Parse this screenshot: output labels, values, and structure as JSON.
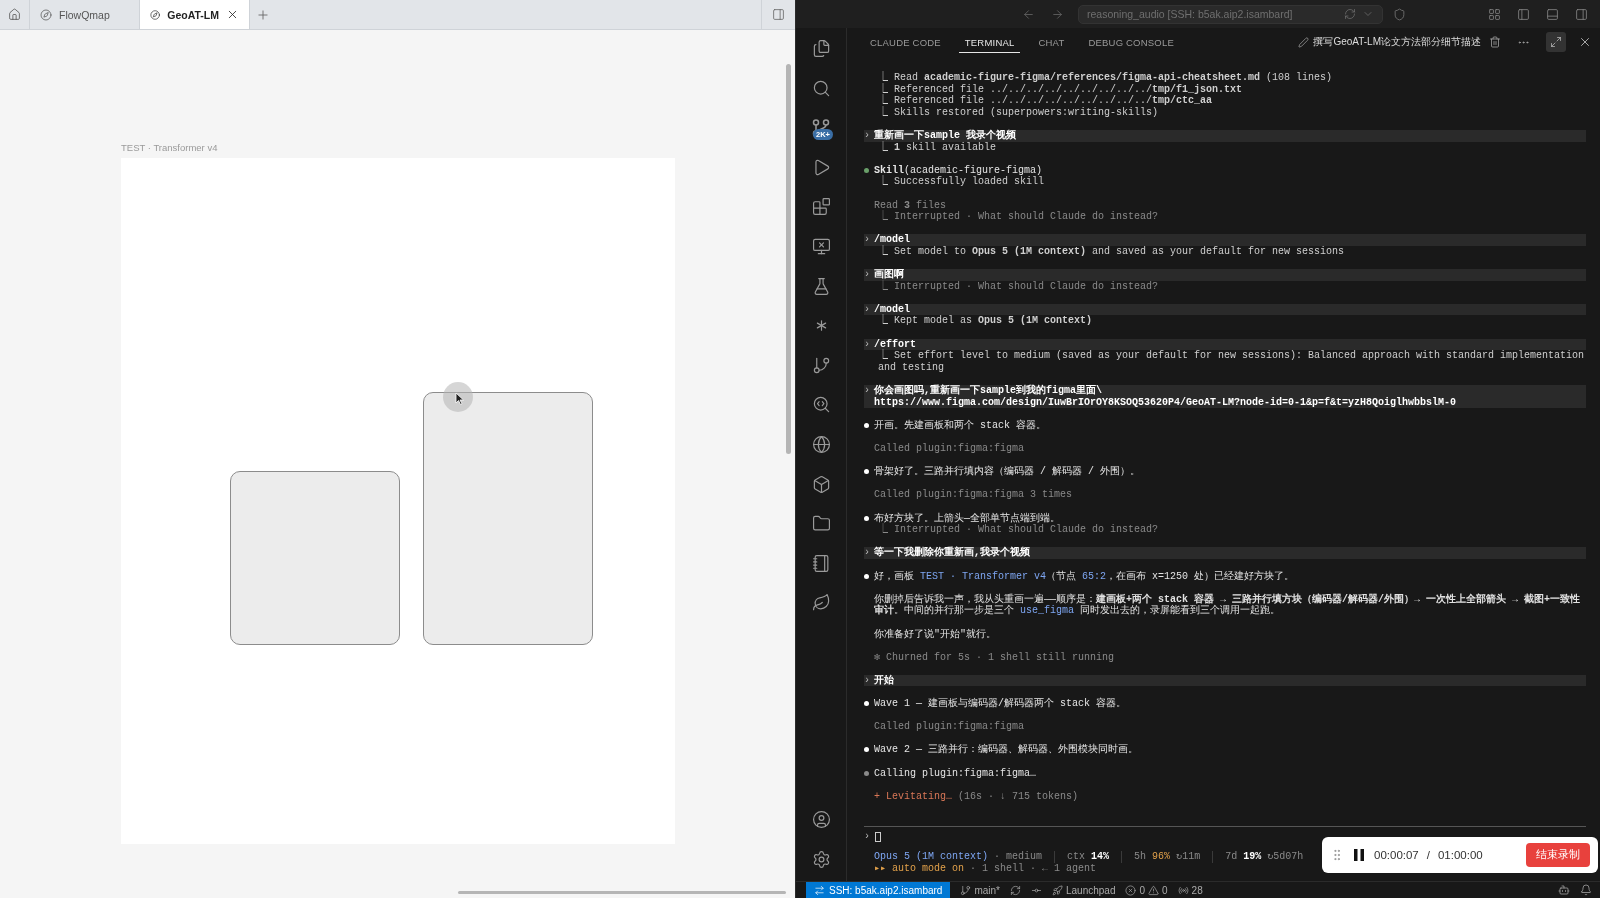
{
  "browser": {
    "tabs": [
      {
        "label": "FlowQmap",
        "selected": false
      },
      {
        "label": "GeoAT-LM",
        "selected": true
      }
    ]
  },
  "canvas": {
    "frame_label": "TEST · Transformer v4"
  },
  "editor": {
    "title_search": "reasoning_audio [SSH: b5ak.aip2.isambard]",
    "activity_badge": "2K+",
    "panel_tabs": [
      {
        "label": "CLAUDE CODE",
        "selected": false
      },
      {
        "label": "TERMINAL",
        "selected": true
      },
      {
        "label": "CHAT",
        "selected": false
      },
      {
        "label": "DEBUG CONSOLE",
        "selected": false
      }
    ],
    "session_title": "撰写GeoAT-LM论文方法部分细节描述"
  },
  "terminal": {
    "groups": [
      {
        "lines": [
          {
            "kind": "tree",
            "muted": false,
            "text": "⎿ Read **academic-figure-figma/references/figma-api-cheatsheet.md** (108 lines)"
          },
          {
            "kind": "tree",
            "muted": false,
            "text": "⎿ Referenced file ../../../../../../../../../**tmp/f1_json.txt**"
          },
          {
            "kind": "tree",
            "muted": false,
            "text": "⎿ Referenced file ../../../../../../../../../**tmp/ctc_aa**"
          },
          {
            "kind": "tree",
            "muted": false,
            "text": "⎿ Skills restored (superpowers:writing-skills)"
          }
        ]
      },
      {
        "lines": [
          {
            "kind": "prompt",
            "marker": "›",
            "text": "重新画一下sample 我录个视频"
          },
          {
            "kind": "tree",
            "muted": false,
            "text": "⎿ **1** skill available"
          }
        ]
      },
      {
        "lines": [
          {
            "kind": "bullet",
            "color": "#6aa06a",
            "text": "**Skill**(academic-figure-figma)"
          },
          {
            "kind": "tree",
            "muted": false,
            "text": "⎿ Successfully loaded skill"
          }
        ]
      },
      {
        "lines": [
          {
            "kind": "note",
            "muted": true,
            "text": "Read **3** files"
          },
          {
            "kind": "tree",
            "muted": true,
            "text": "⎿ Interrupted · What should Claude do instead?"
          }
        ]
      },
      {
        "lines": [
          {
            "kind": "prompt",
            "marker": "›",
            "text": "/model"
          },
          {
            "kind": "tree",
            "muted": false,
            "text": "⎿ Set model to **Opus 5 (1M context)** and saved as your default for new sessions"
          }
        ]
      },
      {
        "lines": [
          {
            "kind": "prompt",
            "marker": "›",
            "text": "画图啊"
          },
          {
            "kind": "tree",
            "muted": true,
            "text": "⎿ Interrupted · What should Claude do instead?"
          }
        ]
      },
      {
        "lines": [
          {
            "kind": "prompt",
            "marker": "›",
            "text": "/model"
          },
          {
            "kind": "tree",
            "muted": false,
            "text": "⎿ Kept model as **Opus 5 (1M context)**"
          }
        ]
      },
      {
        "lines": [
          {
            "kind": "prompt",
            "marker": "›",
            "text": "/effort"
          },
          {
            "kind": "tree",
            "muted": false,
            "text": "⎿ Set effort level to medium (saved as your default for new sessions): Balanced approach with standard implementation and testing"
          }
        ]
      },
      {
        "lines": [
          {
            "kind": "prompt",
            "marker": "›",
            "text": "你会画图吗,重新画一下sample到我的figma里面\\\nhttps://www.figma.com/design/IuwBrIOrOY8KSOQ53620P4/GeoAT-LM?node-id=0-1&p=f&t=yzH8QoiglhwbbslM-0"
          }
        ]
      },
      {
        "lines": [
          {
            "kind": "bullet",
            "color": "#ffffff",
            "text": "开画。先建画板和两个 stack 容器。"
          }
        ]
      },
      {
        "lines": [
          {
            "kind": "note",
            "muted": true,
            "text": "Called plugin:figma:figma"
          }
        ]
      },
      {
        "lines": [
          {
            "kind": "bullet",
            "color": "#ffffff",
            "text": "骨架好了。三路并行填内容（编码器 / 解码器 / 外围）。"
          }
        ]
      },
      {
        "lines": [
          {
            "kind": "note",
            "muted": true,
            "text": "Called plugin:figma:figma 3 times"
          }
        ]
      },
      {
        "lines": [
          {
            "kind": "bullet",
            "color": "#ffffff",
            "text": "布好方块了。上箭头—全部单节点端到端。"
          },
          {
            "kind": "tree",
            "muted": true,
            "text": "⎿ Interrupted · What should Claude do instead?"
          }
        ]
      },
      {
        "lines": [
          {
            "kind": "prompt",
            "marker": "›",
            "text": "等一下我删除你重新画,我录个视频"
          }
        ]
      },
      {
        "lines": [
          {
            "kind": "bullet",
            "color": "#ffffff",
            "segments": [
              {
                "text": "好，画板 ",
                "kind": "plain"
              },
              {
                "text": "TEST · Transformer v4",
                "kind": "link"
              },
              {
                "text": "（节点 ",
                "kind": "plain"
              },
              {
                "text": "65:2",
                "kind": "link"
              },
              {
                "text": "，在画布 x=1250 处）已经建好方块了。",
                "kind": "plain"
              }
            ]
          }
        ]
      },
      {
        "lines": [
          {
            "kind": "note",
            "muted": false,
            "segments": [
              {
                "text": "你删掉后告诉我一声，我从头重画一遍——顺序是：**建画板+两个 stack 容器 → 三路并行填方块（编码器/解码器/外围）→ 一次性上全部箭头 → 截图+一致性审计**。中间的并行那一步是三个 ",
                "kind": "plain"
              },
              {
                "text": "use_figma",
                "kind": "link"
              },
              {
                "text": " 同时发出去的，录屏能看到三个调用一起跑。",
                "kind": "plain"
              }
            ]
          }
        ]
      },
      {
        "lines": [
          {
            "kind": "note",
            "muted": false,
            "text": "你准备好了说\"开始\"就行。"
          }
        ]
      },
      {
        "lines": [
          {
            "kind": "note",
            "muted": true,
            "text": "✻ Churned for 5s · 1 shell still running"
          }
        ]
      },
      {
        "lines": [
          {
            "kind": "prompt",
            "marker": "›",
            "text": "开始"
          }
        ]
      },
      {
        "lines": [
          {
            "kind": "bullet",
            "color": "#ffffff",
            "text": "Wave 1 — 建画板与编码器/解码器两个 stack 容器。"
          }
        ]
      },
      {
        "lines": [
          {
            "kind": "note",
            "muted": true,
            "text": "Called plugin:figma:figma"
          }
        ]
      },
      {
        "lines": [
          {
            "kind": "bullet",
            "color": "#ffffff",
            "text": "Wave 2 — 三路并行：编码器、解码器、外围模块同时画。"
          }
        ]
      },
      {
        "lines": [
          {
            "kind": "bullet",
            "color": "#8a8a8a",
            "text": "Calling plugin:figma:figma…"
          }
        ]
      },
      {
        "lines": [
          {
            "kind": "note",
            "muted": false,
            "segments": [
              {
                "text": "+ Levitating…",
                "kind": "accent"
              },
              {
                "text": " (16s · ↓ 715 tokens)",
                "kind": "dim"
              }
            ]
          }
        ]
      }
    ],
    "input_marker": "›",
    "footer": {
      "model": [
        {
          "text": "Opus 5 (1M context)",
          "kind": "link"
        },
        {
          "text": " · medium",
          "kind": "dim"
        }
      ],
      "metrics": [
        [
          {
            "text": "ctx ",
            "kind": "dim"
          },
          {
            "text": "14%",
            "kind": "bold"
          }
        ],
        [
          {
            "text": "5h ",
            "kind": "dim"
          },
          {
            "text": "96%",
            "kind": "warn"
          },
          {
            "text": " ↻11m",
            "kind": "dim"
          }
        ],
        [
          {
            "text": "7d ",
            "kind": "dim"
          },
          {
            "text": "19%",
            "kind": "bold"
          },
          {
            "text": " ↻5d07h",
            "kind": "dim"
          }
        ]
      ],
      "mode": [
        {
          "text": "▸▸ auto mode on",
          "kind": "warn"
        },
        {
          "text": " · 1 shell · ← 1 agent",
          "kind": "dim"
        }
      ]
    }
  },
  "recorder": {
    "elapsed": "00:00:07",
    "separator": "/",
    "limit": "01:00:00",
    "stop_label": "结束录制"
  },
  "status_bar": {
    "remote": "SSH: b5ak.aip2.isambard",
    "branch": "main*",
    "launchpad": "Launchpad",
    "errors": "0",
    "warnings": "0",
    "ports": "28"
  }
}
